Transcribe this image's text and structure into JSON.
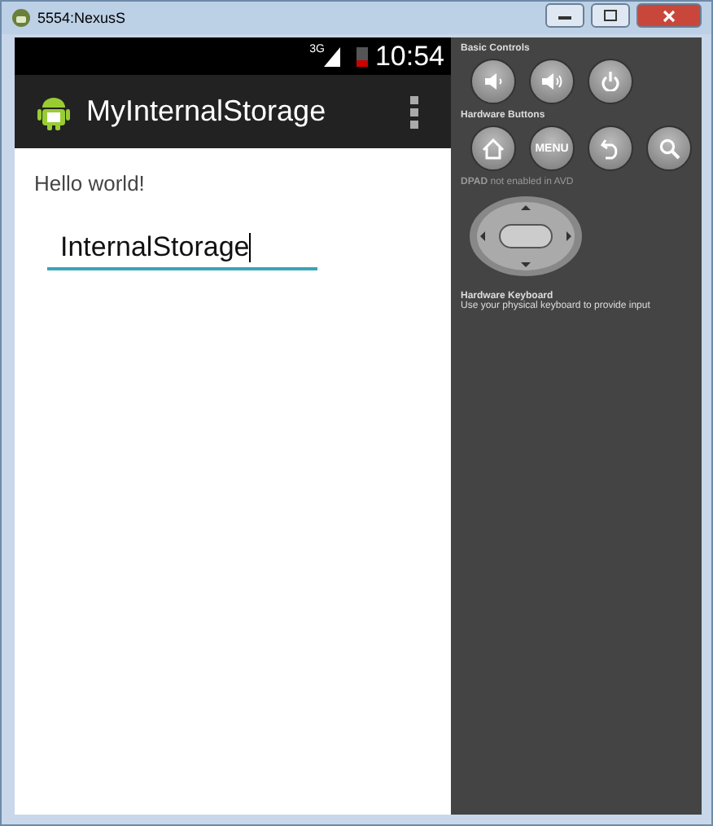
{
  "window": {
    "title": "5554:NexusS"
  },
  "status_bar": {
    "network": "3G",
    "time": "10:54"
  },
  "action_bar": {
    "title": "MyInternalStorage"
  },
  "content": {
    "text": "Hello world!",
    "field": {
      "value": "InternalStorage"
    }
  },
  "controls": {
    "basic": {
      "title": "Basic Controls",
      "buttons": [
        {
          "kind": "volume-down"
        },
        {
          "kind": "volume-up"
        },
        {
          "kind": "power"
        }
      ]
    },
    "hardware": {
      "title": "Hardware Buttons",
      "buttons": [
        {
          "kind": "home"
        },
        {
          "kind": "menu",
          "label": "MENU"
        },
        {
          "kind": "back"
        },
        {
          "kind": "search"
        }
      ]
    },
    "dpad": {
      "caption": "**DPAD** not enabled in AVD"
    },
    "keyboard": {
      "title": "Hardware Keyboard",
      "text": "Use your physical keyboard to provide input"
    }
  }
}
